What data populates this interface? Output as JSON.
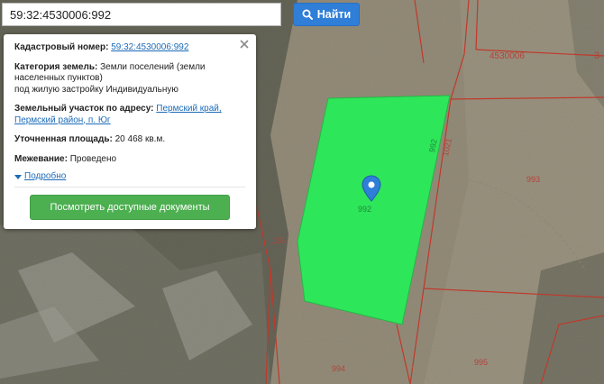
{
  "search": {
    "value": "59:32:4530006:992",
    "button_label": "Найти",
    "button_icon": "search-icon"
  },
  "popup": {
    "cadastral_label": "Кадастровый номер:",
    "cadastral_value": "59:32:4530006:992",
    "category_label": "Категория земель:",
    "category_value": "Земли поселений (земли населенных пунктов)",
    "category_note": "под жилую застройку Индивидуальную",
    "address_label": "Земельный участок по адресу:",
    "address_value": "Пермский край, Пермский район, п. Юг",
    "area_label": "Уточненная площадь:",
    "area_value": "20 468 кв.м.",
    "survey_label": "Межевание:",
    "survey_value": "Проведено",
    "more_label": "Подробно",
    "docs_button": "Посмотреть доступные документы"
  },
  "map": {
    "labels": {
      "block_id": "4530006",
      "block_id_partial": "3",
      "plot_992": "992",
      "plot_993": "993",
      "plot_994": "994",
      "plot_995": "995",
      "plot_135": "135",
      "plot_1021": "1021",
      "plot_992_side": "992"
    },
    "colors": {
      "parcel_fill": "#2ee65a",
      "boundary": "#c0392b",
      "marker": "#2f7ed8",
      "button_blue": "#2f7ed8",
      "button_green": "#4caf50"
    }
  }
}
